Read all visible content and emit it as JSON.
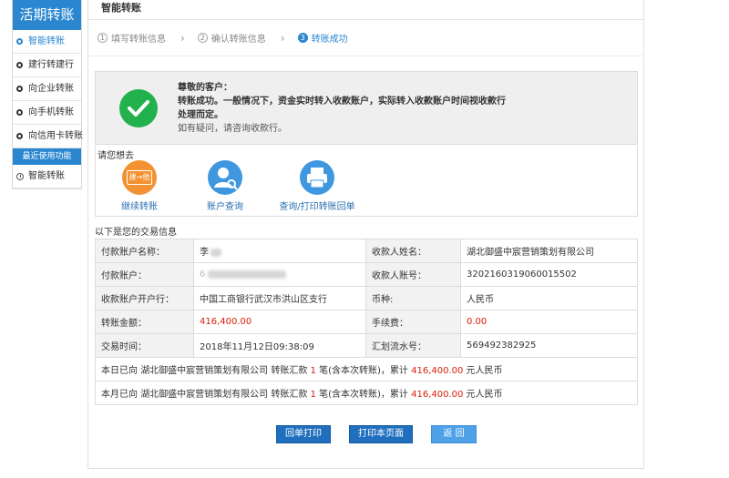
{
  "sidebar": {
    "title": "活期转账",
    "items": [
      {
        "label": "智能转账"
      },
      {
        "label": "建行转建行"
      },
      {
        "label": "向企业转账"
      },
      {
        "label": "向手机转账"
      },
      {
        "label": "向信用卡转账"
      }
    ],
    "recent_header": "最近使用功能",
    "recent_items": [
      {
        "label": "智能转账"
      }
    ]
  },
  "main": {
    "title": "智能转账",
    "steps": [
      {
        "num": "1",
        "label": "填写转账信息"
      },
      {
        "num": "2",
        "label": "确认转账信息"
      },
      {
        "num": "3",
        "label": "转账成功"
      }
    ],
    "notice": {
      "greeting": "尊敬的客户：",
      "message": "转账成功。一般情况下，资金实时转入收款账户，实际转入收款账户时间视收款行处理而定。",
      "hint": "如有疑问，请咨询收款行。"
    },
    "quick": {
      "title": "请您想去",
      "items": [
        {
          "label": "继续转账",
          "icon_text": "建→他"
        },
        {
          "label": "账户查询"
        },
        {
          "label": "查询/打印转账回单"
        }
      ]
    },
    "info_title": "以下是您的交易信息",
    "table": {
      "payer_name_label": "付款账户名称：",
      "payer_name": "李",
      "payee_name_label": "收款人姓名：",
      "payee_name": "湖北御盛中宸营销策划有限公司",
      "payer_account_label": "付款账户：",
      "payer_account": "6",
      "payee_account_label": "收款人账号：",
      "payee_account": "3202160319060015502",
      "payee_bank_label": "收款账户开户行：",
      "payee_bank": "中国工商银行武汉市洪山区支行",
      "currency_label": "币种:",
      "currency": "人民币",
      "amount_label": "转账金额：",
      "amount": "416,400.00",
      "fee_label": "手续费：",
      "fee": "0.00",
      "time_label": "交易时间：",
      "time": "2018年11月12日09:38:09",
      "serial_label": "汇划流水号：",
      "serial": "569492382925",
      "today_prefix": "本日已向 湖北御盛中宸营销策划有限公司 转账汇款 ",
      "today_count": "1",
      "today_mid": " 笔(含本次转账)，累计 ",
      "today_amount": "416,400.00",
      "today_suffix": " 元人民币",
      "month_prefix": "本月已向 湖北御盛中宸营销策划有限公司 转账汇款 ",
      "month_count": "1",
      "month_mid": " 笔(含本次转账)，累计 ",
      "month_amount": "416,400.00",
      "month_suffix": " 元人民币"
    },
    "buttons": {
      "print_receipt": "回单打印",
      "print_page": "打印本页面",
      "back": "返 回"
    }
  }
}
